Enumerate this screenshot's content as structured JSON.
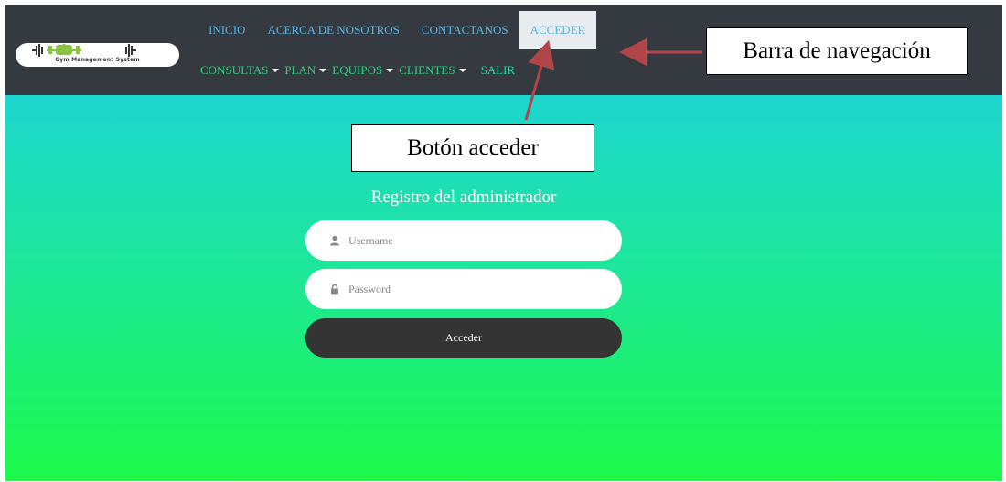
{
  "brand": {
    "logo_text": "Gym Management System",
    "accent": "#8ac43f"
  },
  "nav": {
    "top_links": [
      {
        "label": "INICIO"
      },
      {
        "label": "ACERCA DE NOSOTROS"
      },
      {
        "label": "CONTACTANOS"
      },
      {
        "label": "ACCEDER",
        "active": true
      }
    ],
    "dropdowns": [
      {
        "label": "CONSULTAS"
      },
      {
        "label": "PLAN"
      },
      {
        "label": "EQUIPOS"
      },
      {
        "label": "CLIENTES"
      }
    ],
    "logout_label": "SALIR",
    "link_color": "#5ab4e4",
    "dropdown_color": "#2fd17e"
  },
  "login": {
    "title": "Registro del administrador",
    "username_placeholder": "Username",
    "password_placeholder": "Password",
    "submit_label": "Acceder",
    "user_icon": "user-icon",
    "lock_icon": "lock-icon"
  },
  "annotations": {
    "navbar_callout": "Barra de navegación",
    "button_callout": "Botón acceder",
    "arrow_color": "#b0454a"
  },
  "colors": {
    "navbar_bg": "#343a40",
    "gradient_top": "#1dd6cf",
    "gradient_bottom": "#1cf94a",
    "button_bg": "#343434"
  }
}
